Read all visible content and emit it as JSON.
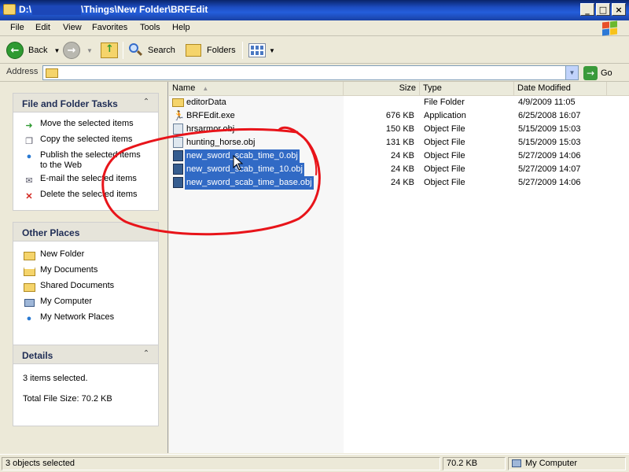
{
  "window": {
    "title_prefix": "D:\\",
    "title_suffix": "\\Things\\New Folder\\BRFEdit",
    "controls": [
      "_",
      "□",
      "×"
    ]
  },
  "menu": [
    "File",
    "Edit",
    "View",
    "Favorites",
    "Tools",
    "Help"
  ],
  "toolbar": {
    "back": "Back",
    "search": "Search",
    "folders": "Folders",
    "forward_icon": "forward-arrow-icon",
    "up_icon": "folder-up-icon",
    "views_icon": "views-icon"
  },
  "address": {
    "label": "Address",
    "value": "",
    "go": "Go"
  },
  "tasks": {
    "file_folder": {
      "title": "File and Folder Tasks",
      "items": [
        "Move the selected items",
        "Copy the selected items",
        "Publish the selected items to the Web",
        "E-mail the selected items",
        "Delete the selected items"
      ]
    },
    "other_places": {
      "title": "Other Places",
      "items": [
        "New Folder",
        "My Documents",
        "Shared Documents",
        "My Computer",
        "My Network Places"
      ]
    },
    "details": {
      "title": "Details",
      "selected": "3 items selected.",
      "total": "Total File Size: 70.2 KB"
    }
  },
  "columns": {
    "name": "Name",
    "size": "Size",
    "type": "Type",
    "date": "Date Modified"
  },
  "files": [
    {
      "name": "editorData",
      "size": "",
      "type": "File Folder",
      "date": "4/9/2009 11:05"
    },
    {
      "name": "BRFEdit.exe",
      "size": "676 KB",
      "type": "Application",
      "date": "6/25/2008 16:07"
    },
    {
      "name": "hrsarmor.obj",
      "size": "150 KB",
      "type": "Object File",
      "date": "5/15/2009 15:03"
    },
    {
      "name": "hunting_horse.obj",
      "size": "131 KB",
      "type": "Object File",
      "date": "5/15/2009 15:03"
    },
    {
      "name": "new_sword_scab_time_0.obj",
      "size": "24 KB",
      "type": "Object File",
      "date": "5/27/2009 14:06"
    },
    {
      "name": "new_sword_scab_time_10.obj",
      "size": "24 KB",
      "type": "Object File",
      "date": "5/27/2009 14:07"
    },
    {
      "name": "new_sword_scab_time_base.obj",
      "size": "24 KB",
      "type": "Object File",
      "date": "5/27/2009 14:06"
    }
  ],
  "status": {
    "objects": "3 objects selected",
    "size": "70.2 KB",
    "zone": "My Computer"
  },
  "colors": {
    "selection": "#316ac5",
    "annotation": "#e8141a",
    "titlebar": "#245edb"
  }
}
